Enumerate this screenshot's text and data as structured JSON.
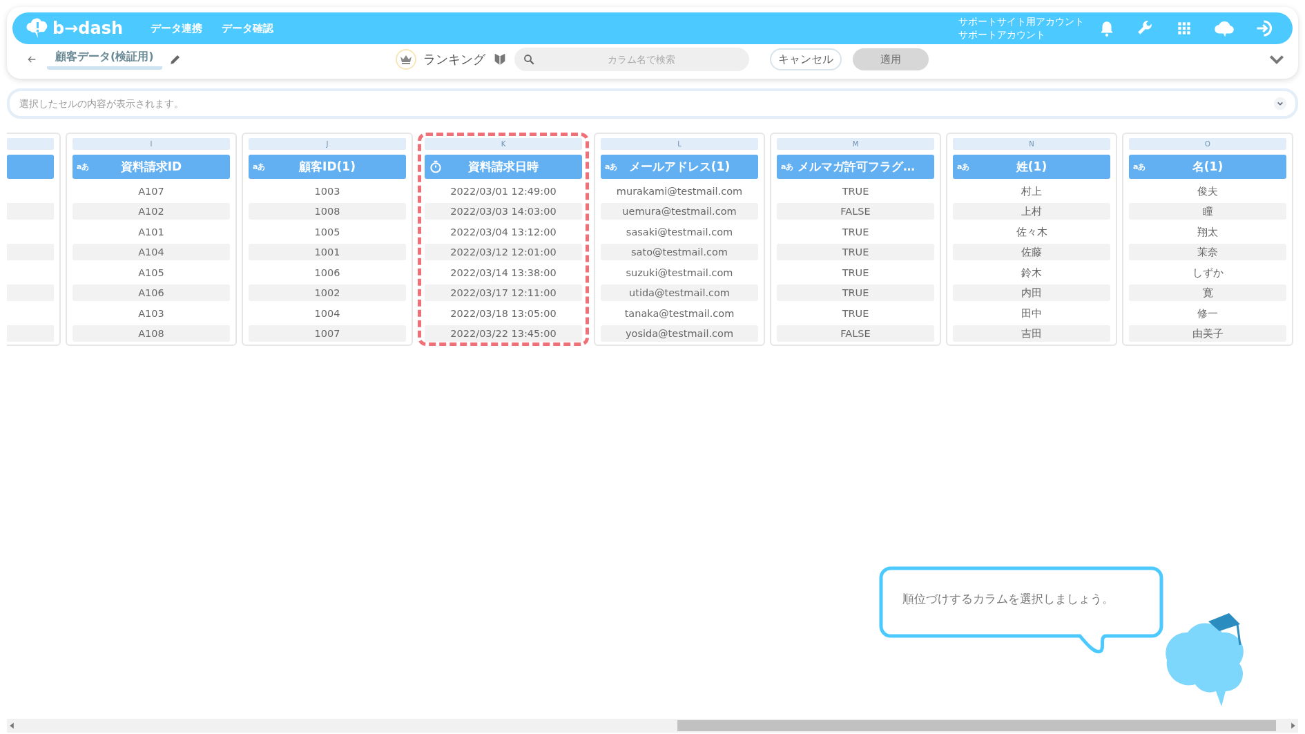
{
  "header": {
    "logo": "b→dash",
    "nav": [
      {
        "label": "データ連携"
      },
      {
        "label": "データ確認"
      }
    ],
    "account": [
      "サポートサイト用アカウント",
      "サポートアカウント"
    ]
  },
  "toolbar": {
    "title": "顧客データ(検証用)",
    "mode": "ランキング",
    "search": {
      "placeholder": "カラム名で検索"
    },
    "cancel": "キャンセル",
    "apply": {
      "label": "適用",
      "disabled": true
    }
  },
  "cell_view": {
    "placeholder": "選択したセルの内容が表示されます。"
  },
  "columns": [
    {
      "letter": "I",
      "kind": "text",
      "type_label": "aあ",
      "title": "資料請求ID",
      "highlighted": false,
      "cells": [
        "A107",
        "A102",
        "A101",
        "A104",
        "A105",
        "A106",
        "A103",
        "A108"
      ]
    },
    {
      "letter": "J",
      "kind": "text",
      "type_label": "aあ",
      "title": "顧客ID(1)",
      "highlighted": false,
      "cells": [
        "1003",
        "1008",
        "1005",
        "1001",
        "1006",
        "1002",
        "1004",
        "1007"
      ]
    },
    {
      "letter": "K",
      "kind": "datetime",
      "title": "資料請求日時",
      "highlighted": true,
      "cells": [
        "2022/03/01 12:49:00",
        "2022/03/03 14:03:00",
        "2022/03/04 13:12:00",
        "2022/03/12 12:01:00",
        "2022/03/14 13:38:00",
        "2022/03/17 12:11:00",
        "2022/03/18 13:05:00",
        "2022/03/22 13:45:00"
      ]
    },
    {
      "letter": "L",
      "kind": "text",
      "type_label": "aあ",
      "title": "メールアドレス(1)",
      "highlighted": false,
      "cells": [
        "murakami@testmail.com",
        "uemura@testmail.com",
        "sasaki@testmail.com",
        "sato@testmail.com",
        "suzuki@testmail.com",
        "utida@testmail.com",
        "tanaka@testmail.com",
        "yosida@testmail.com"
      ]
    },
    {
      "letter": "M",
      "kind": "text",
      "type_label": "aあ",
      "title": "メルマガ許可フラグ…",
      "highlighted": false,
      "cells": [
        "TRUE",
        "FALSE",
        "TRUE",
        "TRUE",
        "TRUE",
        "TRUE",
        "TRUE",
        "FALSE"
      ]
    },
    {
      "letter": "N",
      "kind": "text",
      "type_label": "aあ",
      "title": "姓(1)",
      "highlighted": false,
      "cells": [
        "村上",
        "上村",
        "佐々木",
        "佐藤",
        "鈴木",
        "内田",
        "田中",
        "吉田"
      ]
    },
    {
      "letter": "O",
      "kind": "text",
      "type_label": "aあ",
      "title": "名(1)",
      "highlighted": false,
      "cells": [
        "俊夫",
        "瞳",
        "翔太",
        "茉奈",
        "しずか",
        "寛",
        "修一",
        "由美子"
      ]
    }
  ],
  "tip": {
    "text": "順位づけするカラムを選択しましょう。"
  }
}
